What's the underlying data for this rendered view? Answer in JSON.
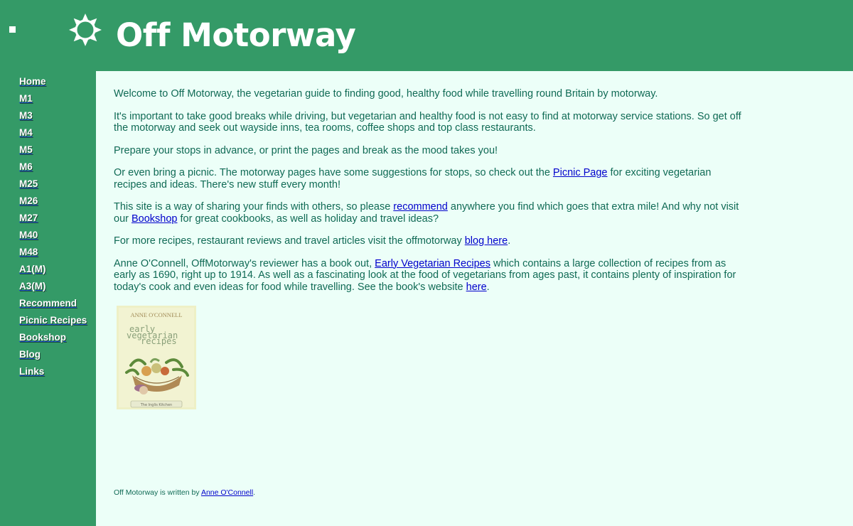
{
  "header": {
    "title": "Off Motorway",
    "logo_icon": "sun-icon",
    "bullet_icon": "square-bullet-icon"
  },
  "sidebar": {
    "items": [
      {
        "label": "Home"
      },
      {
        "label": "M1"
      },
      {
        "label": "M3"
      },
      {
        "label": "M4"
      },
      {
        "label": "M5"
      },
      {
        "label": "M6"
      },
      {
        "label": "M25"
      },
      {
        "label": "M26"
      },
      {
        "label": "M27"
      },
      {
        "label": "M40"
      },
      {
        "label": "M48"
      },
      {
        "label": "A1(M)"
      },
      {
        "label": "A3(M)"
      },
      {
        "label": "Recommend"
      },
      {
        "label": "Picnic Recipes"
      },
      {
        "label": "Bookshop"
      },
      {
        "label": "Blog"
      },
      {
        "label": "Links"
      }
    ]
  },
  "main": {
    "p1": "Welcome to Off Motorway, the vegetarian guide to finding good, healthy food while travelling round Britain by motorway.",
    "p2": "It's important to take good breaks while driving, but vegetarian and healthy food is not easy to find at motorway service stations.  So get off the motorway and seek out wayside inns, tea rooms, coffee shops and top class restaurants.",
    "p3": "Prepare your stops in advance, or print the pages and break as the mood takes you!",
    "p4_before": "Or even bring a picnic.  The motorway pages have some suggestions for stops, so check out the ",
    "p4_link": "Picnic Page",
    "p4_after": " for exciting vegetarian recipes and ideas.  There's new stuff every month!",
    "p5_before": "This site is a way of sharing your finds with others, so please ",
    "p5_link1": "recommend",
    "p5_middle": " anywhere you find which goes that extra mile!  And why not visit our ",
    "p5_link2": "Bookshop",
    "p5_after": " for great cookbooks, as well as holiday and travel ideas?",
    "p6_before": "For more recipes, restaurant reviews and travel articles visit the offmotorway ",
    "p6_link": "blog here",
    "p6_after": ".",
    "p7_before": "Anne O'Connell, OffMotorway's reviewer has a book out, ",
    "p7_link1": "Early Vegetarian Recipes",
    "p7_middle": " which contains a large collection of recipes from as early as 1690, right up to 1914.  As well as a fascinating look at the food of vegetarians from ages past, it contains plenty of inspiration for today's cook and even ideas for food while travelling.  See the book's website ",
    "p7_link2": "here",
    "p7_after": ".",
    "book_cover": {
      "author": "ANNE O'CONNELL",
      "title_line1": "early",
      "title_line2": "vegetarian",
      "title_line3": "recipes",
      "publisher": "The Inglis Kitchen"
    }
  },
  "footer": {
    "before": "Off Motorway is written by ",
    "link": "Anne O'Connell",
    "after": "."
  },
  "colors": {
    "green": "#349a67",
    "background": "#ecfff8",
    "text": "#106a55",
    "link": "#0000cc"
  }
}
